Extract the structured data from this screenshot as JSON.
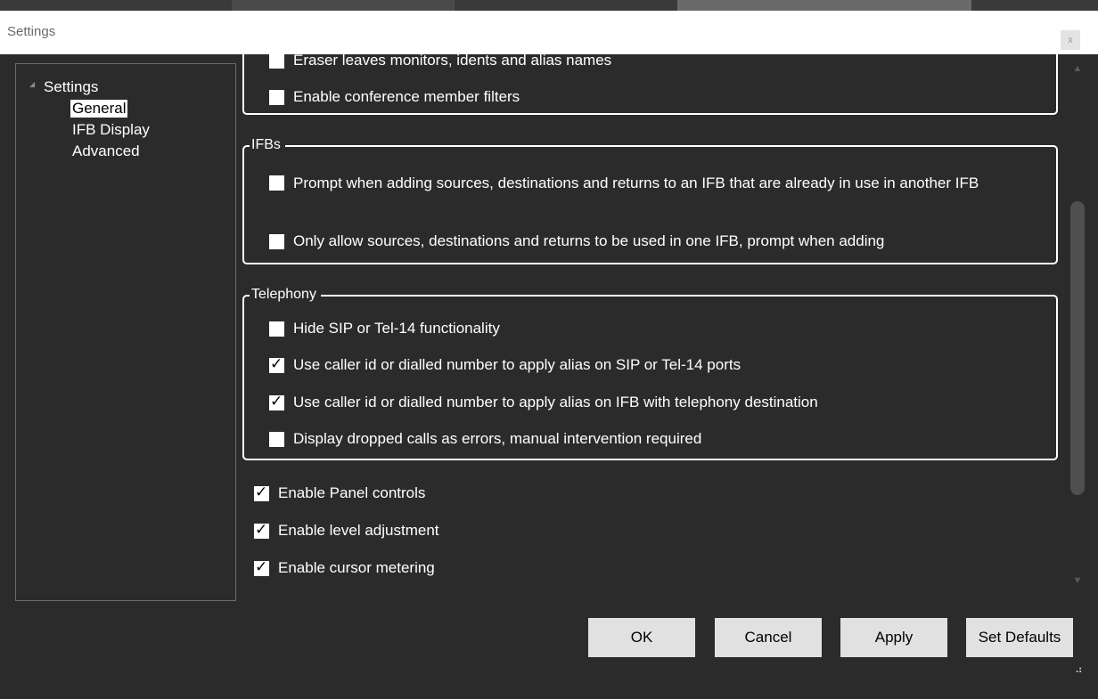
{
  "window": {
    "title": "Settings",
    "close_label": "x"
  },
  "tree": {
    "root": "Settings",
    "items": [
      {
        "label": "General",
        "selected": true
      },
      {
        "label": "IFB Display",
        "selected": false
      },
      {
        "label": "Advanced",
        "selected": false
      }
    ]
  },
  "top_group": {
    "options": [
      {
        "label": "Eraser leaves monitors, idents and alias names",
        "checked": false
      },
      {
        "label": "Enable conference member filters",
        "checked": false
      }
    ]
  },
  "ifbs_group": {
    "legend": "IFBs",
    "options": [
      {
        "label": "Prompt when adding sources, destinations and returns to an IFB that are already in use in another IFB",
        "checked": false
      },
      {
        "label": "Only allow sources, destinations and returns to be used in one IFB, prompt when adding",
        "checked": false
      }
    ]
  },
  "telephony_group": {
    "legend": "Telephony",
    "options": [
      {
        "label": "Hide SIP or Tel-14 functionality",
        "checked": false
      },
      {
        "label": "Use caller id or dialled number to apply alias on SIP or Tel-14 ports",
        "checked": true
      },
      {
        "label": "Use caller id or dialled number to apply alias on IFB with telephony destination",
        "checked": true
      },
      {
        "label": "Display dropped calls as errors, manual intervention required",
        "checked": false
      }
    ]
  },
  "panel_options": [
    {
      "label": "Enable Panel controls",
      "checked": true
    },
    {
      "label": "Enable level adjustment",
      "checked": true
    },
    {
      "label": "Enable cursor metering",
      "checked": true
    }
  ],
  "scrollbar": {
    "up_icon": "▲",
    "down_icon": "▼"
  },
  "buttons": {
    "ok": "OK",
    "cancel": "Cancel",
    "apply": "Apply",
    "set_defaults": "Set Defaults"
  },
  "colors": {
    "background": "#2b2b2b",
    "button": "#e1e1e1",
    "titlebar": "#ffffff"
  }
}
